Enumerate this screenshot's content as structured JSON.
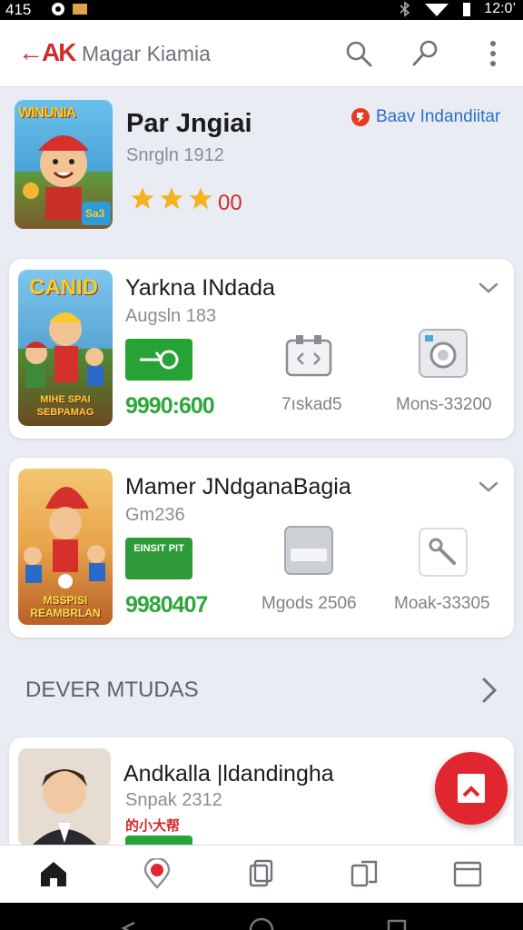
{
  "status_bar": {
    "time_left": "415",
    "time_right": "12:0’"
  },
  "app_bar": {
    "logo_text": "←AK",
    "title": "Magar Kiamia",
    "icons": [
      "search-icon",
      "key-icon",
      "more-vert-icon"
    ]
  },
  "featured": {
    "title": "Par Jngiai",
    "subtitle": "Snrgln 1912",
    "rating_value": "00",
    "stars": 3,
    "badge_text": "Baav Indandiitar",
    "thumb_caption": "WINUNIA",
    "thumb_corner": "Sa3"
  },
  "cards": [
    {
      "title": "Yarkna INdada",
      "subtitle": "Augsln 183",
      "price": "9990:600",
      "thumb_top": "CANID",
      "thumb_bottom": "MIHE SPAI SEBPAMAG",
      "button_icon": "key-icon",
      "meta": [
        {
          "icon": "controller-icon",
          "label": "7ıskad5"
        },
        {
          "icon": "camera-icon",
          "label": "Mons-33200"
        }
      ]
    },
    {
      "title": "Mamer JNdganaBagia",
      "subtitle": "Gm236",
      "price": "9980407",
      "thumb_top": "",
      "thumb_bottom": "MSSPISI REAMBRLAN",
      "button_text": "EINSIT PIT",
      "meta": [
        {
          "icon": "card-icon",
          "label": "Mgods 2506"
        },
        {
          "icon": "wrench-icon",
          "label": "Moak-33305"
        }
      ]
    }
  ],
  "section": {
    "title": "DEVER MTUDAS"
  },
  "partial_card": {
    "title": "Andkalla |ldandingha",
    "subtitle": "Snpak 2312",
    "tag": "的小大帮"
  },
  "bottom_nav": [
    "home-icon",
    "location-pin-icon",
    "copy-icon",
    "pages-icon",
    "window-icon"
  ],
  "colors": {
    "accent_red": "#e0262f",
    "price_green": "#2ea63a",
    "badge_blue": "#2a6fc9"
  }
}
